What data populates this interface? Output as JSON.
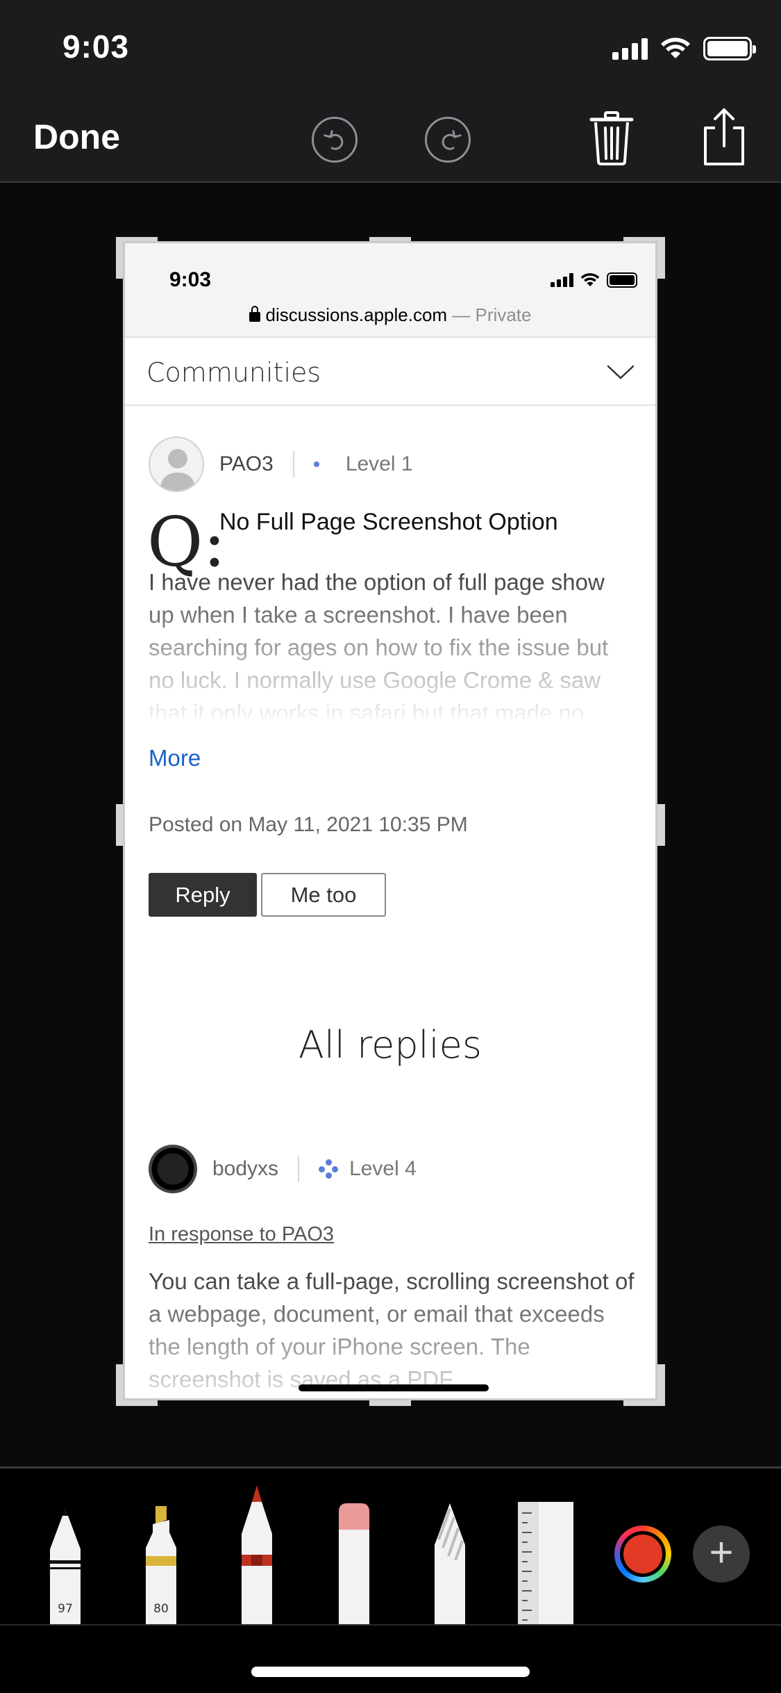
{
  "status_bar": {
    "time": "9:03"
  },
  "toolbar": {
    "done_label": "Done"
  },
  "screenshot": {
    "status_time": "9:03",
    "url": "discussions.apple.com",
    "url_suffix": " — Private",
    "communities_label": "Communities",
    "question": {
      "author": "PAO3",
      "level": "Level 1",
      "q_glyph": "Q:",
      "title": "No Full Page Screenshot Option",
      "body": "I have never had the option of full page show up when I take a screenshot. I have been searching for ages on how to fix the issue but no luck. I normally use Google Crome & saw that it only works in safari but that made no difference, there are no icons at the top to",
      "more_label": "More",
      "posted": "Posted on May 11, 2021 10:35 PM",
      "reply_label": "Reply",
      "metoo_label": "Me too"
    },
    "all_replies_heading": "All replies",
    "reply": {
      "author": "bodyxs",
      "level": "Level 4",
      "in_response": "In response to PAO3",
      "body": "You can take a full-page, scrolling screenshot of a webpage, document, or email that exceeds the length of your iPhone screen. The screenshot is saved as a PDF."
    }
  },
  "palette": {
    "tools": [
      {
        "name": "pen",
        "number": "97"
      },
      {
        "name": "marker",
        "number": "80"
      },
      {
        "name": "pencil"
      },
      {
        "name": "eraser"
      },
      {
        "name": "lasso"
      },
      {
        "name": "ruler"
      }
    ],
    "selected_color": "#e23a24",
    "add_label": "+"
  }
}
